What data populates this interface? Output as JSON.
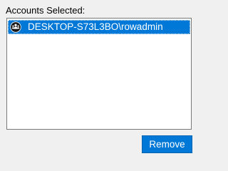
{
  "accounts_section": {
    "label": "Accounts Selected:",
    "items": [
      {
        "label": "DESKTOP-S73L3BO\\rowadmin",
        "icon": "user-group-icon",
        "selected": true
      }
    ]
  },
  "actions": {
    "remove_label": "Remove"
  },
  "colors": {
    "selection": "#0078d7",
    "button": "#0078d7",
    "background": "#f0f0f0",
    "list_background": "#ffffff"
  }
}
